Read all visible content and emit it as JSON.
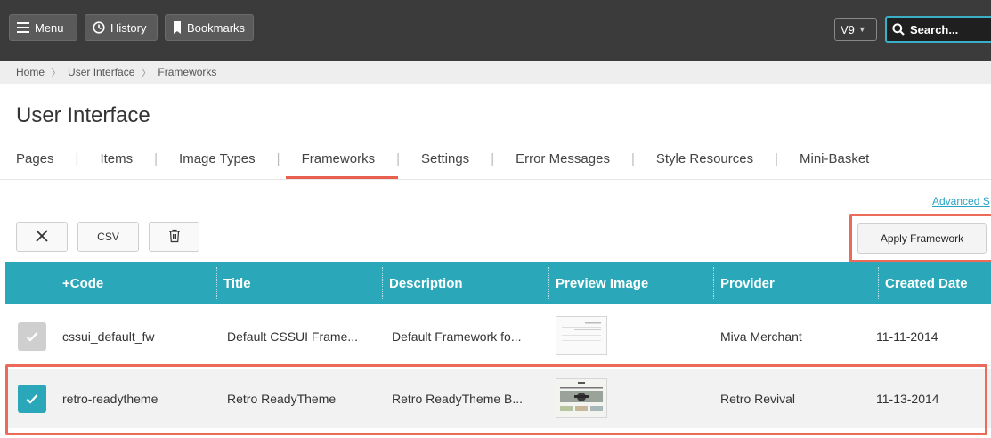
{
  "topbar": {
    "menu_label": "Menu",
    "history_label": "History",
    "bookmarks_label": "Bookmarks",
    "version": "V9",
    "search_placeholder": "Search..."
  },
  "breadcrumb": [
    "Home",
    "User Interface",
    "Frameworks"
  ],
  "page_title": "User Interface",
  "tabs": [
    {
      "label": "Pages"
    },
    {
      "label": "Items"
    },
    {
      "label": "Image Types"
    },
    {
      "label": "Frameworks",
      "active": true
    },
    {
      "label": "Settings"
    },
    {
      "label": "Error Messages"
    },
    {
      "label": "Style Resources"
    },
    {
      "label": "Mini-Basket"
    }
  ],
  "advanced_link": "Advanced S",
  "toolbar": {
    "csv_label": "CSV",
    "apply_label": "Apply Framework"
  },
  "table": {
    "columns": [
      "+Code",
      "Title",
      "Description",
      "Preview Image",
      "Provider",
      "Created Date"
    ],
    "rows": [
      {
        "code": "cssui_default_fw",
        "title": "Default CSSUI Frame...",
        "description": "Default Framework fo...",
        "provider": "Miva Merchant",
        "created": "11-11-2014",
        "checked": false
      },
      {
        "code": "retro-readytheme",
        "title": "Retro ReadyTheme",
        "description": "Retro ReadyTheme B...",
        "provider": "Retro Revival",
        "created": "11-13-2014",
        "checked": true
      }
    ]
  },
  "colors": {
    "topbar": "#3b3b3b",
    "accent": "#2aa7b8",
    "highlight": "#ec6a58"
  }
}
